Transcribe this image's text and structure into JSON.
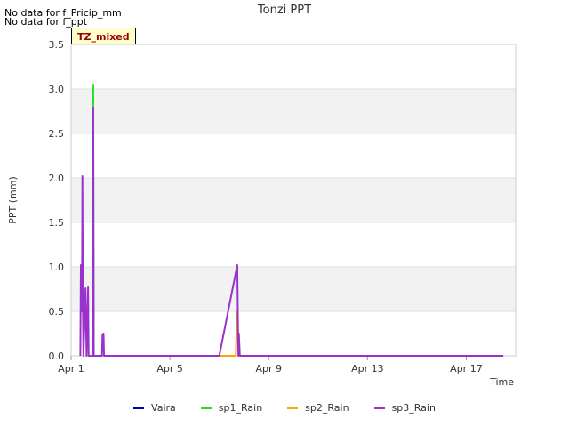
{
  "notes": [
    "No data for f_Pricip_mm",
    "No data for f_ppt"
  ],
  "badge": "TZ_mixed",
  "colors": {
    "Vaira": "#0000bb",
    "sp1_Rain": "#22dd22",
    "sp2_Rain": "#ffa500",
    "sp3_Rain": "#9932cc"
  },
  "chart_data": {
    "type": "line",
    "title": "Tonzi PPT",
    "xlabel": "Time",
    "ylabel": "PPT (mm)",
    "ylim": [
      0,
      3.5
    ],
    "xlim": [
      "2024-04-01",
      "2024-04-19"
    ],
    "y_ticks": [
      "0.0",
      "0.5",
      "1.0",
      "1.5",
      "2.0",
      "2.5",
      "3.0",
      "3.5"
    ],
    "x_ticks": [
      {
        "label": "Apr 1",
        "date": "2024-04-01"
      },
      {
        "label": "Apr 5",
        "date": "2024-04-05"
      },
      {
        "label": "Apr 9",
        "date": "2024-04-09"
      },
      {
        "label": "Apr 13",
        "date": "2024-04-13"
      },
      {
        "label": "Apr 17",
        "date": "2024-04-17"
      }
    ],
    "grid": true,
    "legend_position": "bottom",
    "series": [
      {
        "name": "Vaira",
        "points": []
      },
      {
        "name": "sp1_Rain",
        "points": [
          [
            "2024-04-01 21:00",
            0
          ],
          [
            "2024-04-01 21:30",
            3.05
          ],
          [
            "2024-04-01 22:00",
            0
          ]
        ]
      },
      {
        "name": "sp2_Rain",
        "points": [
          [
            "2024-04-07 00:00",
            0
          ],
          [
            "2024-04-07 16:00",
            0
          ],
          [
            "2024-04-07 17:30",
            0.5
          ],
          [
            "2024-04-07 19:00",
            0
          ]
        ]
      },
      {
        "name": "sp3_Rain",
        "points": [
          [
            "2024-04-01 09:00",
            0
          ],
          [
            "2024-04-01 09:30",
            1.02
          ],
          [
            "2024-04-01 10:30",
            0.5
          ],
          [
            "2024-04-01 11:00",
            2.02
          ],
          [
            "2024-04-01 11:30",
            0.5
          ],
          [
            "2024-04-01 12:00",
            0
          ],
          [
            "2024-04-01 14:00",
            0.76
          ],
          [
            "2024-04-01 15:00",
            0
          ],
          [
            "2024-04-01 16:30",
            0.77
          ],
          [
            "2024-04-01 17:00",
            0
          ],
          [
            "2024-04-01 21:00",
            0
          ],
          [
            "2024-04-01 21:30",
            2.79
          ],
          [
            "2024-04-01 22:00",
            0
          ],
          [
            "2024-04-02 06:00",
            0
          ],
          [
            "2024-04-02 06:30",
            0.24
          ],
          [
            "2024-04-02 07:30",
            0.25
          ],
          [
            "2024-04-02 08:00",
            0
          ],
          [
            "2024-04-07 00:00",
            0
          ],
          [
            "2024-04-07 17:30",
            1.02
          ],
          [
            "2024-04-07 18:30",
            0
          ],
          [
            "2024-04-07 19:00",
            0.25
          ],
          [
            "2024-04-07 20:00",
            0
          ],
          [
            "2024-04-18 12:00",
            0
          ]
        ]
      }
    ]
  }
}
